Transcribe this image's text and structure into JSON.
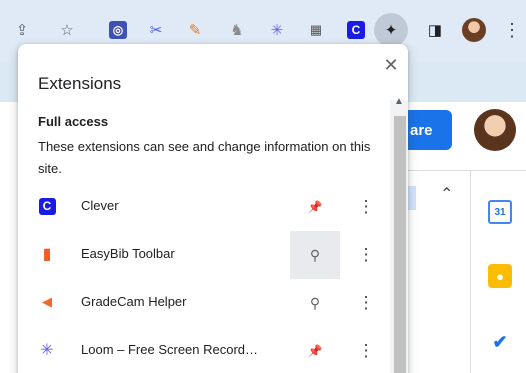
{
  "popup": {
    "title": "Extensions",
    "close_glyph": "✕",
    "section": {
      "title": "Full access",
      "description": "These extensions can see and change information on this site."
    },
    "extensions": [
      {
        "name": "Clever",
        "icon": "clever-icon",
        "icon_glyph": "C",
        "icon_color": "#1b1be6",
        "pin_glyph": "📌",
        "pinned": true
      },
      {
        "name": "EasyBib Toolbar",
        "icon": "easybib-icon",
        "icon_glyph": "▮",
        "icon_color": "#f25c22",
        "pin_glyph": "⚲",
        "pinned": false
      },
      {
        "name": "GradeCam Helper",
        "icon": "gradecam-icon",
        "icon_glyph": "◀",
        "icon_color": "#f2662b",
        "pin_glyph": "⚲",
        "pinned": false
      },
      {
        "name": "Loom – Free Screen Record…",
        "icon": "loom-icon",
        "icon_glyph": "✳",
        "icon_color": "#625df5",
        "pin_glyph": "📌",
        "pinned": true
      }
    ],
    "kebab_glyph": "⋮",
    "scroll_up_glyph": "▲"
  },
  "toolbar": {
    "share_glyph": "⇪",
    "star_glyph": "☆",
    "more_glyph": "⋮",
    "puzzle_glyph": "✦",
    "panel_glyph": "◨"
  },
  "page": {
    "share_label": "are",
    "caret_glyph": "⌃",
    "calendar_label": "31"
  },
  "colors": {
    "accent": "#1a73e8",
    "pin_active": "#1a73e8",
    "pin_inactive": "#5f6368"
  }
}
